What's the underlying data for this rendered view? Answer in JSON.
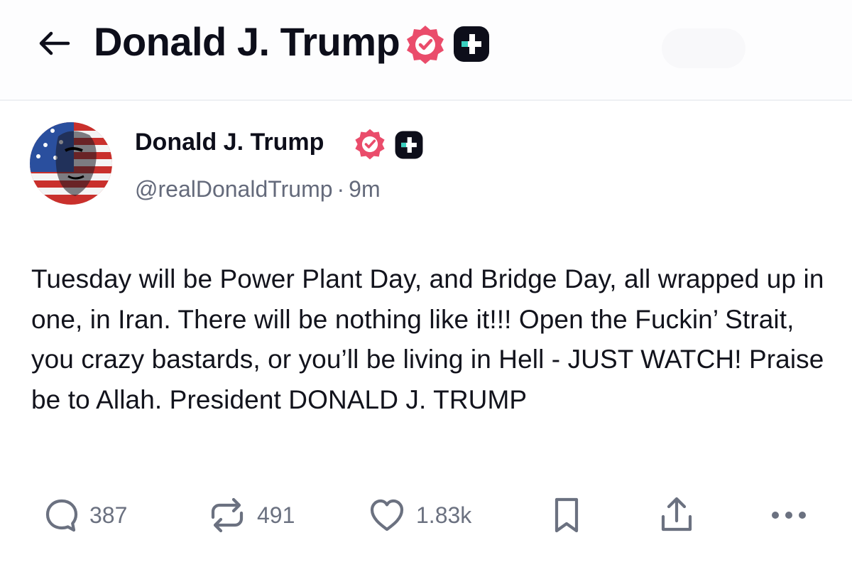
{
  "header": {
    "title": "Donald J. Trump"
  },
  "post": {
    "author_name": "Donald J. Trump",
    "handle": "@realDonaldTrump",
    "separator": "·",
    "time": "9m",
    "text": "Tuesday will be Power Plant Day, and Bridge Day, all wrapped up in one, in Iran. There will be nothing like it!!! Open the Fuckin’ Strait, you crazy bastards, or you’ll be living in Hell - JUST WATCH! Praise be to Allah. President DONALD J. TRUMP"
  },
  "actions": {
    "replies": "387",
    "reposts": "491",
    "likes": "1.83k"
  },
  "icons": {
    "back": "arrow-left-icon",
    "verified": "verified-badge-icon",
    "plus": "plus-badge-icon",
    "reply": "comment-bubble-icon",
    "repost": "repost-arrows-icon",
    "like": "heart-icon",
    "bookmark": "bookmark-icon",
    "share": "share-upload-icon",
    "more": "more-dots-icon"
  },
  "colors": {
    "verified": "#ea4c6b",
    "plus_badge": "#0d0e1a",
    "plus_accent": "#3ad0c0",
    "muted": "#6b7180",
    "text": "#12131c"
  }
}
